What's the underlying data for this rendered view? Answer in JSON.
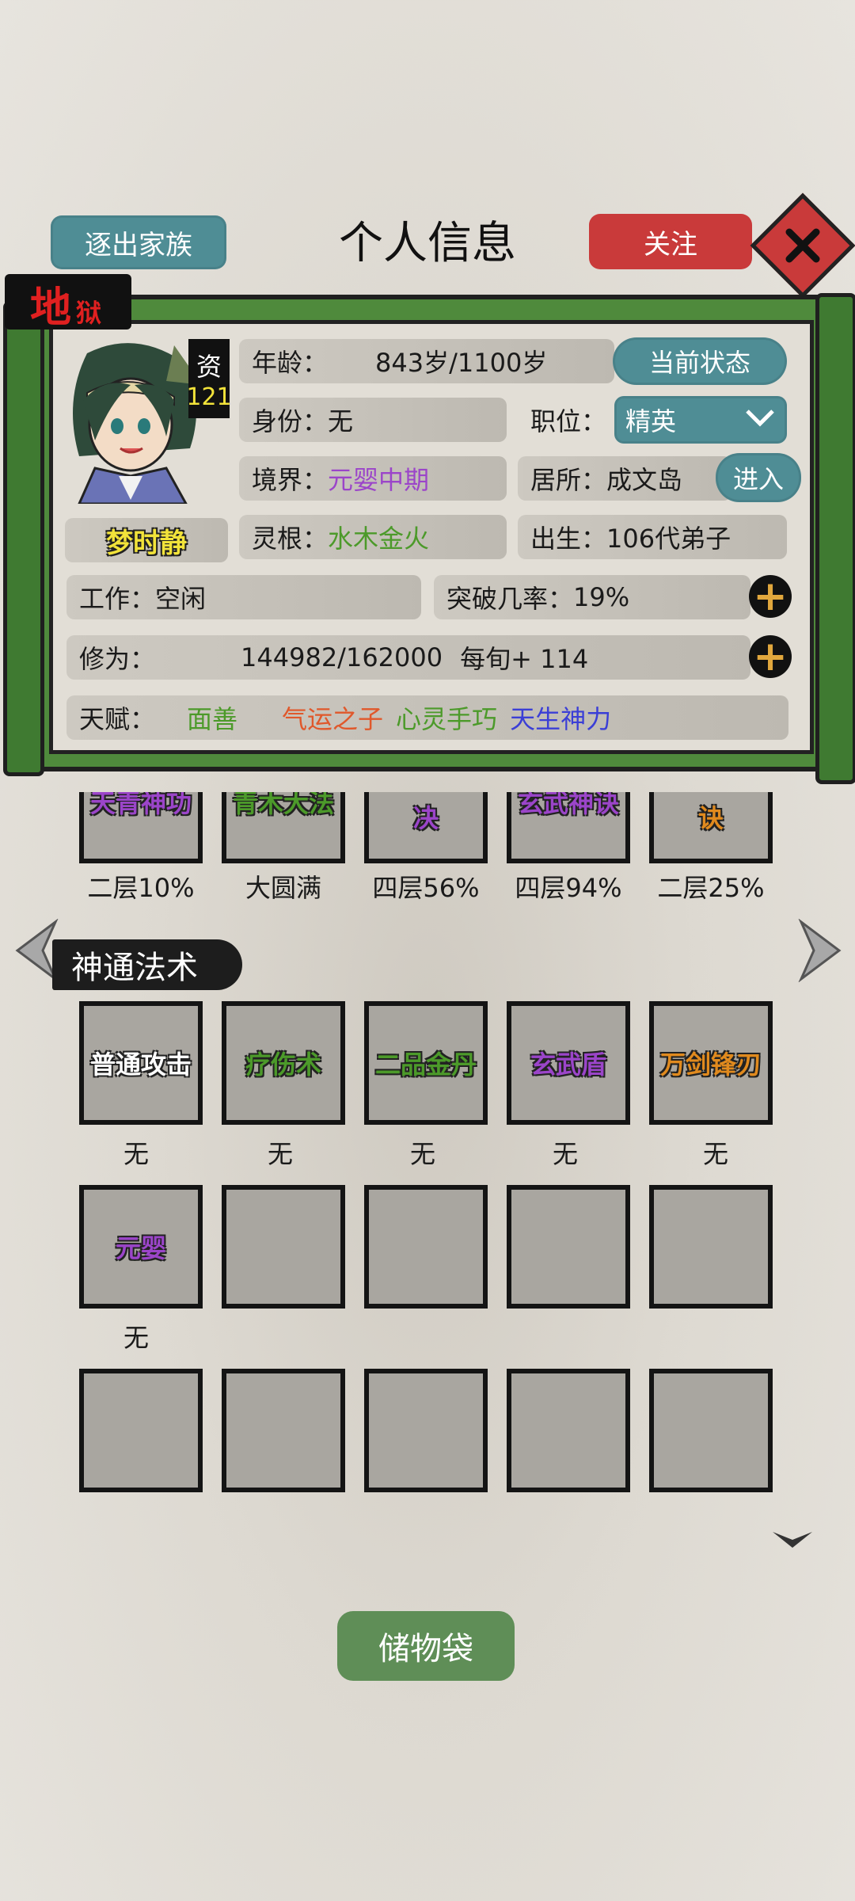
{
  "header": {
    "expel_button": "逐出家族",
    "title": "个人信息",
    "follow_button": "关注"
  },
  "difficulty": {
    "big": "地",
    "small": "狱"
  },
  "character": {
    "aptitude_label": "资",
    "aptitude_value": "121",
    "name": "梦时静",
    "age_label": "年龄：",
    "age_value": "843岁/1100岁",
    "status_button": "当前状态",
    "identity_label": "身份：",
    "identity_value": "无",
    "position_label": "职位：",
    "position_value": "精英",
    "realm_label": "境界：",
    "realm_value": "元婴中期",
    "residence_label": "居所：",
    "residence_value": "成文岛",
    "enter_button": "进入",
    "root_label": "灵根：",
    "root_value": "水木金火",
    "birth_label": "出生：",
    "birth_value": "106代弟子",
    "work_label": "工作：",
    "work_value": "空闲",
    "breakthrough_label": "突破几率：",
    "breakthrough_value": "19%",
    "cultivation_label": "修为：",
    "cultivation_value": "144982/162000",
    "per_turn": "每旬+ 114",
    "talent_label": "天赋：",
    "talents": [
      "面善",
      "气运之子",
      "心灵手巧",
      "天生神力"
    ]
  },
  "colors": {
    "realm": "#9b45c9",
    "root": "#4c9a2a",
    "talent_1": "#4c9a2a",
    "talent_2": "#e0582b",
    "talent_3": "#4c9a2a",
    "talent_4": "#3b3fd6",
    "aptitude": "#f2e33a",
    "name": "#f2e33a"
  },
  "techniques_top": {
    "cells": [
      {
        "name": "天青神功",
        "color": "#9b45c9"
      },
      {
        "name": "青木大法",
        "color": "#4c9a2a"
      },
      {
        "name": "决",
        "color": "#9b45c9"
      },
      {
        "name": "玄武神诀",
        "color": "#9b45c9"
      },
      {
        "name": "诀",
        "color": "#e08a1e"
      }
    ],
    "levels": [
      "二层10%",
      "大圆满",
      "四层56%",
      "四层94%",
      "二层25%"
    ]
  },
  "spells": {
    "title": "神通法术",
    "row1": [
      {
        "name": "普通攻击",
        "color": "#ffffff",
        "level": "无"
      },
      {
        "name": "疗伤术",
        "color": "#4c9a2a",
        "level": "无"
      },
      {
        "name": "二品金丹",
        "color": "#4c9a2a",
        "level": "无"
      },
      {
        "name": "玄武盾",
        "color": "#9b45c9",
        "level": "无"
      },
      {
        "name": "万剑锋刃",
        "color": "#e08a1e",
        "level": "无"
      }
    ],
    "row2_first": {
      "name": "元婴",
      "color": "#9b45c9",
      "level": "无"
    }
  },
  "storage_button": "储物袋"
}
